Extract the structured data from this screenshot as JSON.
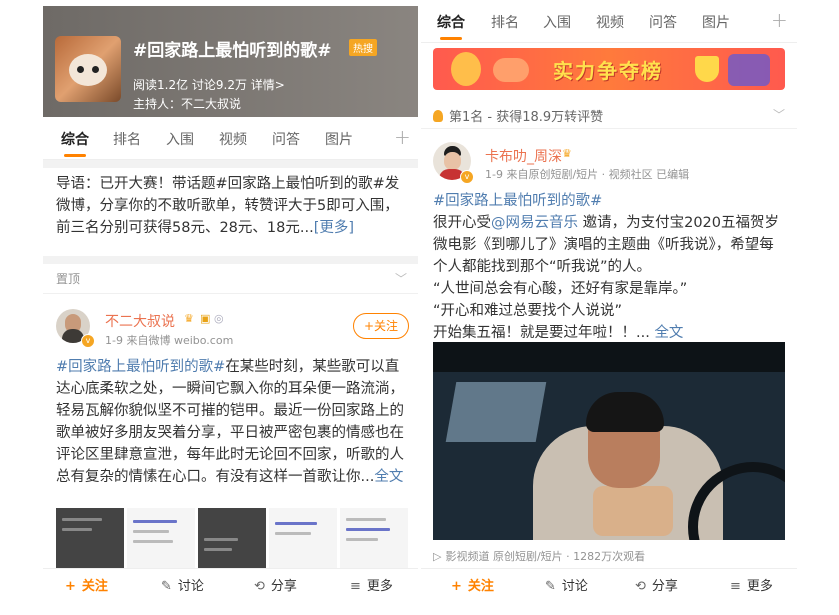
{
  "left": {
    "hero": {
      "title": "#回家路上最怕听到的歌#",
      "badge": "热搜",
      "meta": "阅读1.2亿  讨论9.2万  详情>",
      "host": "主持人：不二大叔说"
    },
    "tabs": [
      "综合",
      "排名",
      "入围",
      "视频",
      "问答",
      "图片"
    ],
    "guide": {
      "prefix": "导语：已开大赛！带话题#回家路上最怕听到的歌#发微博，分享你的不敢听歌单，转赞评大于5即可入围，前三名分别可获得58元、28元、18元...",
      "more": "[更多]"
    },
    "pinned_label": "置顶",
    "post": {
      "user_name": "不二大叔说",
      "meta": "1-9  来自微博 weibo.com",
      "follow_label": "+关注",
      "hashtag": "#回家路上最怕听到的歌#",
      "text": "在某些时刻，某些歌可以直达心底柔软之处，一瞬间它飘入你的耳朵便一路流淌，轻易瓦解你貌似坚不可摧的铠甲。最近一份回家路上的歌单被好多朋友哭着分享，平日被严密包裹的情感也在评论区里肆意宣泄，每年此时无论回不回家，听歌的人总有复杂的情愫在心口。有没有这样一首歌让你...",
      "expand": "全文"
    },
    "actions": [
      "关注",
      "讨论",
      "分享",
      "更多"
    ]
  },
  "right": {
    "tabs": [
      "综合",
      "排名",
      "入围",
      "视频",
      "问答",
      "图片"
    ],
    "banner_text": "实力争夺榜",
    "rank": "第1名 - 获得18.9万转评赞",
    "post": {
      "user_name": "卡布叻_周深",
      "meta": "1-9  来自原创短剧/短片 · 视频社区  已编辑",
      "hashtag": "#回家路上最怕听到的歌#",
      "line1_a": "很开心受",
      "line1_mention": "@网易云音乐",
      "line1_b": " 邀请，为支付宝2020五福贺岁微电影《到哪儿了》演唱的主题曲《听我说》，希望每个人都能找到那个“听我说”的人。",
      "quote1": "“人世间总会有心酸，还好有家是靠岸。”",
      "quote2": "“开心和难过总要找个人说说”",
      "last_line": "开始集五福！就是要过年啦！！... ",
      "expand": "全文"
    },
    "video_meta": "影视频道 原创短剧/短片 · 1282万次观看",
    "actions": [
      "关注",
      "讨论",
      "分享",
      "更多"
    ]
  },
  "colors": {
    "accent": "#ff8200",
    "username": "#eb7350",
    "link": "#507daf"
  }
}
